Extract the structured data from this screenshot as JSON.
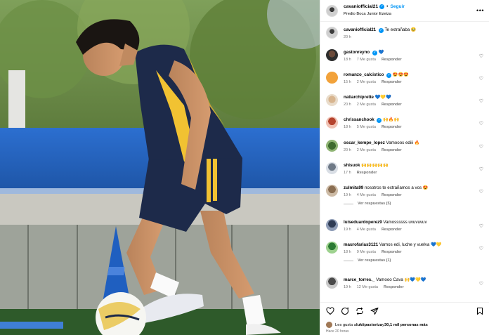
{
  "post": {
    "username": "cavaniofficial21",
    "follow_label": "Seguir",
    "location": "Predio Boca Junior Ezeiza",
    "more_icon": "more-horizontal-icon"
  },
  "caption": {
    "username": "cavaniofficial21",
    "text": "Te extrañaba 🥹",
    "time": "20 h"
  },
  "comments": [
    {
      "username": "gastonreyno",
      "verified": true,
      "text": "💙",
      "time": "18 h",
      "likes": "7 Me gusta",
      "reply": "Responder"
    },
    {
      "username": "romanzo_calcistico",
      "verified": true,
      "text": "😍😍😍",
      "time": "15 h",
      "likes": "2 Me gusta",
      "reply": "Responder"
    },
    {
      "username": "natiarchiprette",
      "verified": false,
      "text": "💙💛💙",
      "time": "20 h",
      "likes": "2 Me gusta",
      "reply": "Responder"
    },
    {
      "username": "chrissanchook",
      "verified": true,
      "text": "🙌🔥🙌",
      "time": "18 h",
      "likes": "5 Me gusta",
      "reply": "Responder"
    },
    {
      "username": "oscar_kempe_lopez",
      "verified": false,
      "text": "Vamooos ediii 🔥",
      "time": "20 h",
      "likes": "2 Me gusta",
      "reply": "Responder"
    },
    {
      "username": "shisuok",
      "verified": false,
      "text": "🙌🙌🙌🙌🙌",
      "time": "17 h",
      "likes": "",
      "reply": "Responder"
    },
    {
      "username": "zulmita99",
      "verified": false,
      "text": "nosotros te extrañamos a vos 😍",
      "time": "19 h",
      "likes": "4 Me gusta",
      "reply": "Responder",
      "view_replies": "Ver respuestas (5)"
    },
    {
      "username": "luiseduardoperez9",
      "verified": false,
      "text": "Vamossssss uvuvuvuv",
      "time": "19 h",
      "likes": "4 Me gusta",
      "reply": "Responder"
    },
    {
      "username": "maurofarias3121",
      "verified": false,
      "text": "Vamos edi, luche y vuelva 💙💛",
      "time": "18 h",
      "likes": "9 Me gusta",
      "reply": "Responder",
      "view_replies": "Ver respuestas (1)"
    },
    {
      "username": "marce_torres._",
      "verified": false,
      "text": "Vamooo Cava 🙌💙💛💙",
      "time": "19 h",
      "likes": "12 Me gusta",
      "reply": "Responder"
    }
  ],
  "actions": {
    "like_icon": "heart-icon",
    "comment_icon": "comment-icon",
    "share_icon": "share-icon",
    "send_icon": "send-icon",
    "save_icon": "bookmark-icon"
  },
  "likes": {
    "prefix": "Les gusta a ",
    "user": "lukiipastoriza",
    "middle": " y ",
    "others": "30,1 mil personas más"
  },
  "ago": "Hace 20 horas",
  "colors": {
    "link_blue": "#0095f6",
    "meta_gray": "#737373",
    "jersey_navy": "#1d2a4a",
    "jersey_gold": "#f1c232",
    "cone_blue": "#1f5fc0"
  }
}
